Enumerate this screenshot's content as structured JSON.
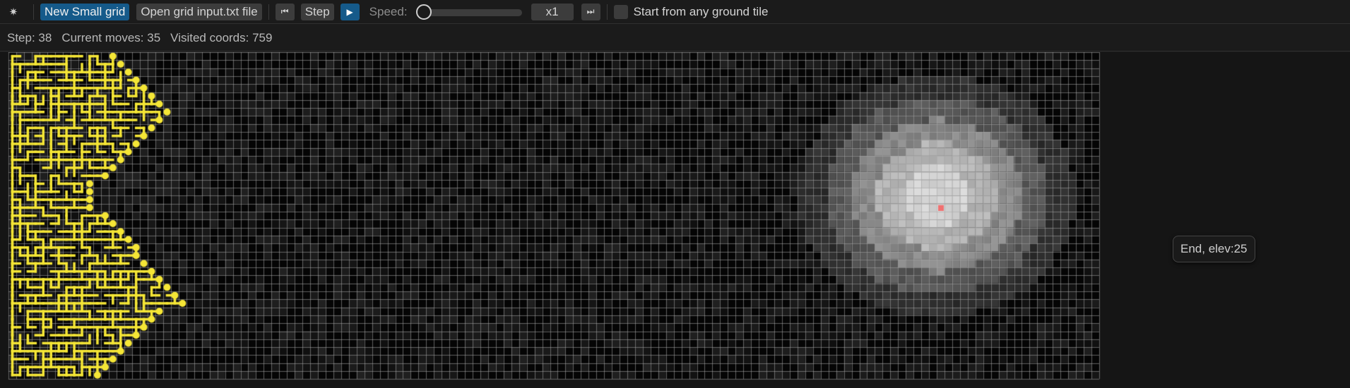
{
  "toolbar": {
    "theme_icon": "sun-icon",
    "new_grid_label": "New Small grid",
    "open_file_label": "Open grid input.txt file",
    "rewind_icon": "skip-back-icon",
    "step_label": "Step",
    "play_icon": "play-icon",
    "speed_label": "Speed:",
    "speed_value": "x1",
    "end_icon": "skip-forward-icon",
    "start_any_label": "Start from any ground tile",
    "start_any_checked": false
  },
  "status": {
    "step": "Step: 38",
    "moves": "Current moves: 35",
    "visited": "Visited coords: 759"
  },
  "grid": {
    "tooltip": "End, elev:25",
    "colors": {
      "path": "#f5e636",
      "end_marker": "#f07070",
      "background": "#151515",
      "grid_line": "#888888"
    }
  },
  "colors": {
    "primary_button": "#155a8a",
    "button": "#3c3c3c",
    "toolbar_bg": "#1b1b1b"
  }
}
